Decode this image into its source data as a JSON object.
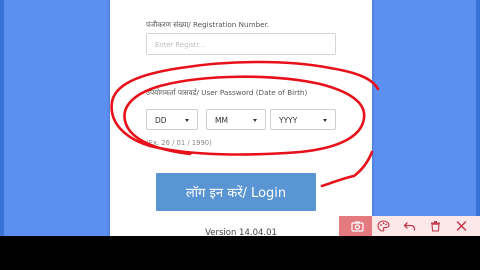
{
  "form": {
    "reg_label": "पंजीकरण संख्या/ Registration Number.",
    "reg_placeholder": "Enter Registr...",
    "pwd_label": "उपयोगकर्ता पासवर्ड/ User Password (Date of Birth)",
    "day_value": "DD",
    "month_value": "MM",
    "year_value": "YYYY",
    "dob_hint": "(Ex. 26 / 01 / 1990)",
    "login_label": "लॉग इन करें/ Login",
    "version": "Version 14.04.01"
  },
  "toolbar": {
    "icons": [
      "camera-icon",
      "palette-icon",
      "undo-icon",
      "trash-icon",
      "close-icon"
    ]
  },
  "colors": {
    "background": "#5b8ff0",
    "login_button": "#5a95d3",
    "annotation": "#e8101a",
    "toolbar_accent": "#e47a80",
    "toolbar_bg": "#fce7e9"
  }
}
